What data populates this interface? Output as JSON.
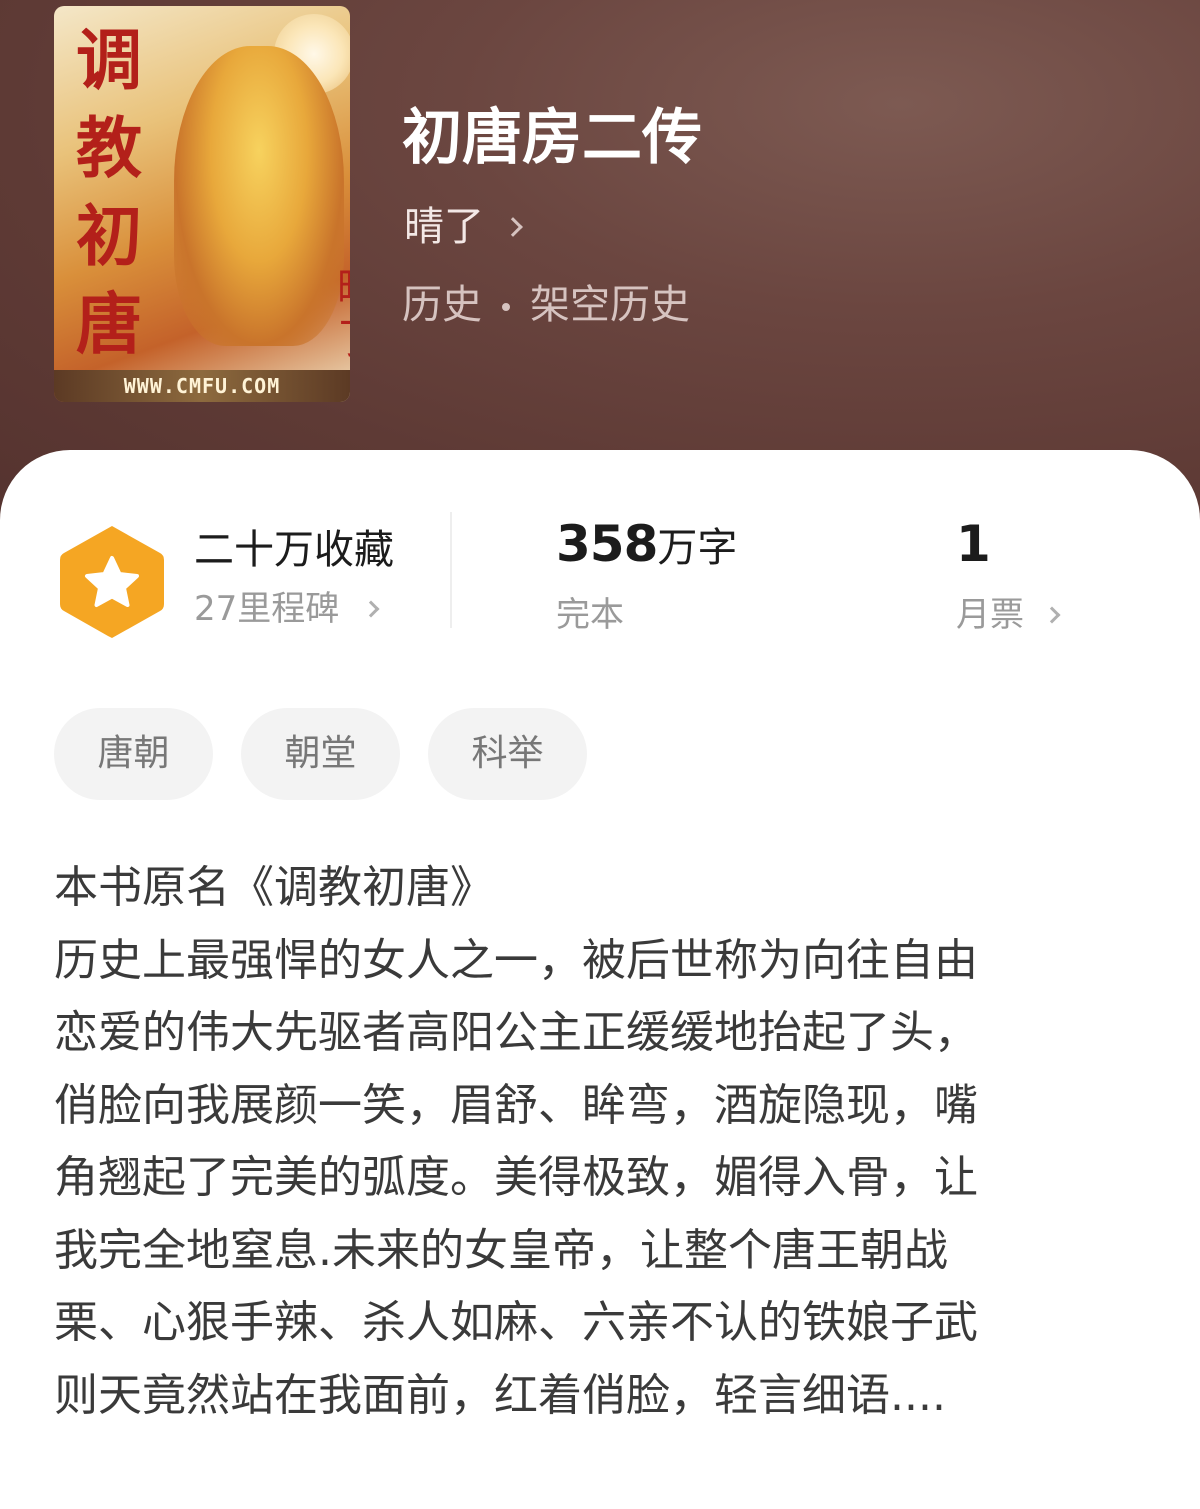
{
  "book": {
    "title": "初唐房二传",
    "author": "晴了",
    "category": "历史",
    "subcategory": "架空历史",
    "cover": {
      "title_glyphs": [
        "调",
        "教",
        "初",
        "唐"
      ],
      "author_glyphs": "晴了",
      "site_text": "WWW.CMFU.COM"
    }
  },
  "stats": {
    "favorites": "二十万收藏",
    "milestones": "27里程碑",
    "word_count_number": "358",
    "word_count_unit": "万字",
    "status": "完本",
    "monthly_tickets": "1",
    "monthly_tickets_label": "月票"
  },
  "tags": [
    "唐朝",
    "朝堂",
    "科举"
  ],
  "intro_lines": [
    "本书原名《调教初唐》",
    "历史上最强悍的女人之一，被后世称为向往自由",
    "恋爱的伟大先驱者高阳公主正缓缓地抬起了头，",
    "俏脸向我展颜一笑，眉舒、眸弯，酒旋隐现，嘴",
    "角翘起了完美的弧度。美得极致，媚得入骨，让",
    "我完全地窒息.未来的女皇帝，让整个唐王朝战",
    "栗、心狠手辣、杀人如麻、六亲不认的铁娘子武",
    "则天竟然站在我面前，红着俏脸，轻言细语...."
  ],
  "colors": {
    "header_bg": "#6b4640",
    "badge_orange": "#f5a623",
    "tag_bg": "#f3f3f3"
  }
}
